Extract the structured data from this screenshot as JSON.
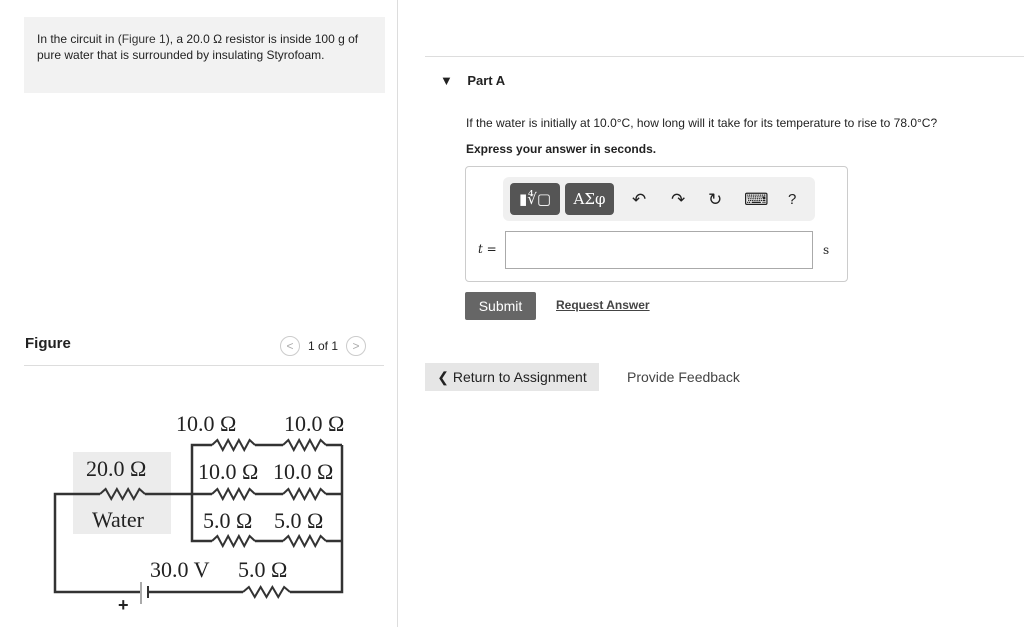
{
  "intro": {
    "pre": "In the circuit in (",
    "link": "Figure 1",
    "post": "), a 20.0 Ω resistor is inside 100 g of pure water that is surrounded by insulating Styrofoam."
  },
  "figure": {
    "label": "Figure",
    "pager": "1 of 1",
    "prev": "<",
    "next": ">",
    "circuit": {
      "r_top1": "10.0 Ω",
      "r_top2": "10.0 Ω",
      "r_mid1": "10.0 Ω",
      "r_mid2": "10.0 Ω",
      "r_bot1": "5.0 Ω",
      "r_bot2": "5.0 Ω",
      "r_water": "20.0 Ω",
      "water": "Water",
      "battery": "30.0 V",
      "r_series": "5.0 Ω",
      "plus": "+"
    }
  },
  "part": {
    "title": "Part A",
    "question": "If the water is initially at 10.0°C, how long will it take for its temperature to rise to 78.0°C?",
    "instruction": "Express your answer in seconds.",
    "toolbar": {
      "templates": "▮∜▢",
      "greek": "ΑΣφ",
      "undo": "↶",
      "redo": "↷",
      "reset": "↻",
      "keyboard": "⌨",
      "help": "?"
    },
    "var": "t =",
    "value": "",
    "unit": "s",
    "submit": "Submit",
    "request": "Request Answer"
  },
  "nav": {
    "return": "Return to Assignment",
    "feedback": "Provide Feedback"
  }
}
